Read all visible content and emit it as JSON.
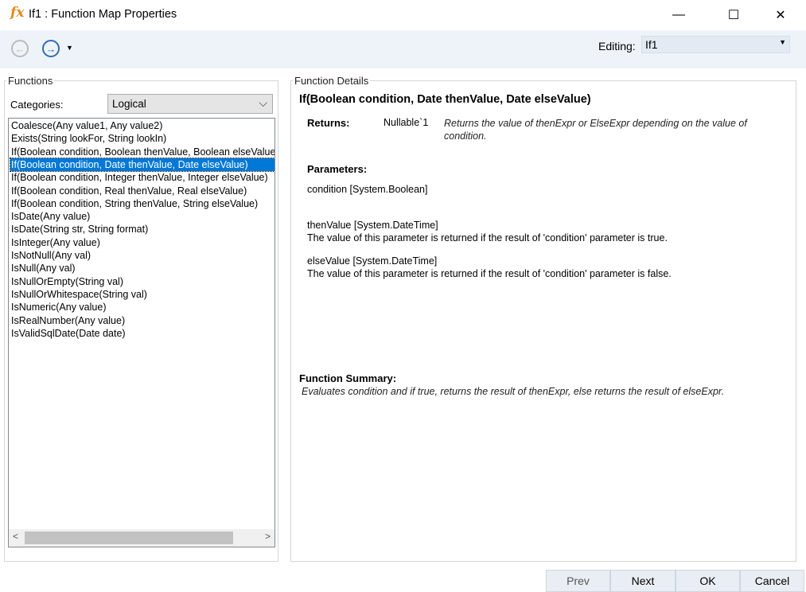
{
  "window": {
    "title": "If1 : Function Map Properties",
    "icon": "fx-icon",
    "minimize": "—",
    "maximize": "☐",
    "close": "✕"
  },
  "toolbar": {
    "back_icon": "arrow-left-circle-icon",
    "forward_icon": "arrow-right-circle-icon",
    "editing_label": "Editing:",
    "editing_value": "If1"
  },
  "functions": {
    "legend": "Functions",
    "categories_label": "Categories:",
    "category_value": "Logical",
    "items": [
      "Coalesce(Any value1, Any value2)",
      "Exists(String lookFor, String lookIn)",
      "If(Boolean condition, Boolean thenValue, Boolean elseValue)",
      "If(Boolean condition, Date thenValue, Date elseValue)",
      "If(Boolean condition, Integer thenValue, Integer elseValue)",
      "If(Boolean condition, Real thenValue, Real elseValue)",
      "If(Boolean condition, String thenValue, String elseValue)",
      "IsDate(Any value)",
      "IsDate(String str, String format)",
      "IsInteger(Any value)",
      "IsNotNull(Any val)",
      "IsNull(Any val)",
      "IsNullOrEmpty(String val)",
      "IsNullOrWhitespace(String val)",
      "IsNumeric(Any value)",
      "IsRealNumber(Any value)",
      "IsValidSqlDate(Date date)"
    ],
    "selected_index": 3
  },
  "details": {
    "legend": "Function Details",
    "signature": "If(Boolean condition, Date thenValue, Date elseValue)",
    "returns_label": "Returns:",
    "returns_type": "Nullable`1",
    "returns_desc": "Returns the value of thenExpr or ElseExpr depending on the value of condition.",
    "parameters_label": "Parameters:",
    "params": [
      {
        "name": "condition [System.Boolean]",
        "desc": ""
      },
      {
        "name": "thenValue [System.DateTime]",
        "desc": "The value of this parameter is returned if the result of 'condition' parameter is true."
      },
      {
        "name": "elseValue [System.DateTime]",
        "desc": "The value of this parameter is returned if the result of 'condition' parameter is false."
      }
    ],
    "summary_label": "Function Summary:",
    "summary": "Evaluates condition and if true, returns the result of thenExpr, else returns the result of elseExpr."
  },
  "buttons": {
    "prev": "Prev",
    "next": "Next",
    "ok": "OK",
    "cancel": "Cancel"
  }
}
